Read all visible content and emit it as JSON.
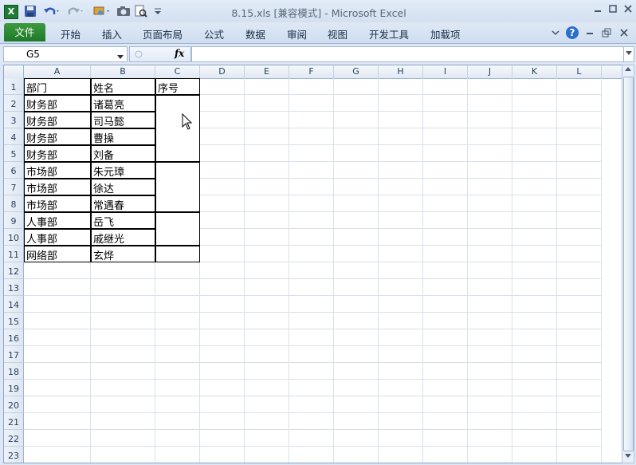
{
  "window": {
    "title": "8.15.xls  [兼容模式]  -  Microsoft Excel",
    "app_icon": "X"
  },
  "ribbon": {
    "file_tab": "文件",
    "tabs": [
      "开始",
      "插入",
      "页面布局",
      "公式",
      "数据",
      "审阅",
      "视图",
      "开发工具",
      "加载项"
    ]
  },
  "formula_bar": {
    "name_box": "G5",
    "fx_label": "fx",
    "content": ""
  },
  "sheet": {
    "columns": [
      "A",
      "B",
      "C",
      "D",
      "E",
      "F",
      "G",
      "H",
      "I",
      "J",
      "K",
      "L"
    ],
    "rows": [
      "1",
      "2",
      "3",
      "4",
      "5",
      "6",
      "7",
      "8",
      "9",
      "10",
      "11",
      "12",
      "13",
      "14",
      "15",
      "16",
      "17",
      "18",
      "19",
      "20",
      "21",
      "22",
      "23"
    ],
    "cells": {
      "A1": "部门",
      "B1": "姓名",
      "C1": "序号",
      "A2": "财务部",
      "B2": "诸葛亮",
      "A3": "财务部",
      "B3": "司马懿",
      "A4": "财务部",
      "B4": "曹操",
      "A5": "财务部",
      "B5": "刘备",
      "A6": "市场部",
      "B6": "朱元璋",
      "A7": "市场部",
      "B7": "徐达",
      "A8": "市场部",
      "B8": "常遇春",
      "A9": "人事部",
      "B9": "岳飞",
      "A10": "人事部",
      "B10": "戚继光",
      "A11": "网络部",
      "B11": "玄烨"
    },
    "merged_c": [
      "C2:C5",
      "C6:C8",
      "C9:C10",
      "C11"
    ]
  },
  "icons": {
    "save": "save-icon",
    "undo": "undo-icon",
    "redo": "redo-icon",
    "help": "help-icon",
    "minimize": "minimize-icon",
    "restore": "restore-icon",
    "close": "close-icon"
  }
}
